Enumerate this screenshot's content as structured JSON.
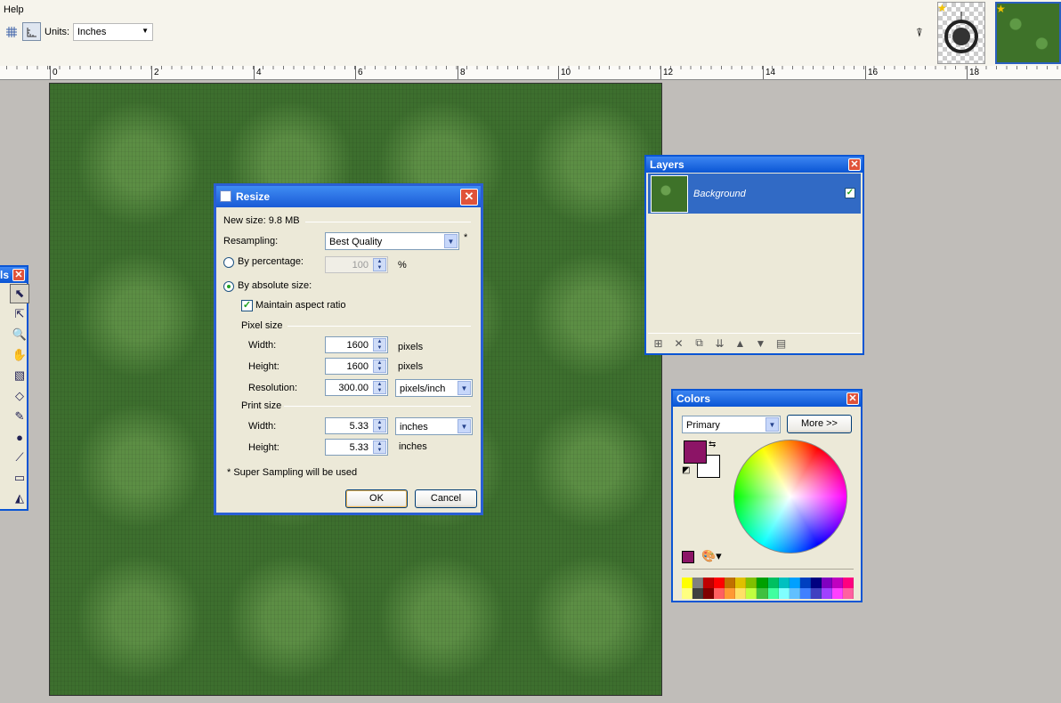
{
  "menu": {
    "help": "Help"
  },
  "toolbar": {
    "units_label": "Units:",
    "units_value": "Inches",
    "grid_icon": "grid-icon",
    "ruler_icon": "ruler-icon"
  },
  "ruler": {
    "labels": [
      "0",
      "2",
      "4",
      "6",
      "8",
      "10",
      "12",
      "14",
      "16",
      "18"
    ]
  },
  "tools_window": {
    "title": "ls"
  },
  "resize_dialog": {
    "title": "Resize",
    "new_size": "New size: 9.8 MB",
    "resampling_label": "Resampling:",
    "resampling_value": "Best Quality",
    "asterisk": "*",
    "by_percentage_label": "By percentage:",
    "percentage_value": "100",
    "percent_sign": "%",
    "by_absolute_label": "By absolute size:",
    "maintain_aspect_label": "Maintain aspect ratio",
    "pixel_size_label": "Pixel size",
    "width_label": "Width:",
    "width_px": "1600",
    "pixels_unit": "pixels",
    "height_label": "Height:",
    "height_px": "1600",
    "resolution_label": "Resolution:",
    "resolution_value": "300.00",
    "resolution_unit": "pixels/inch",
    "print_size_label": "Print size",
    "print_width": "5.33",
    "print_width_unit": "inches",
    "print_height": "5.33",
    "print_height_unit": "inches",
    "note": "* Super Sampling will be used",
    "ok": "OK",
    "cancel": "Cancel"
  },
  "layers_window": {
    "title": "Layers",
    "layer_name": "Background"
  },
  "colors_window": {
    "title": "Colors",
    "primary_select": "Primary",
    "more_button": "More >>",
    "primary_color": "#8c1466",
    "secondary_color": "#ffffff",
    "palette": [
      "#ffff00",
      "#808080",
      "#c00000",
      "#ff0000",
      "#c07000",
      "#e0c000",
      "#80c000",
      "#00a000",
      "#00c060",
      "#00c0c0",
      "#00a0ff",
      "#0040c0",
      "#000080",
      "#8000c0",
      "#c000c0",
      "#ff0080",
      "#ffff80",
      "#404040",
      "#800000",
      "#ff6060",
      "#ff9933",
      "#ffe066",
      "#c0ff40",
      "#40c040",
      "#40ffa0",
      "#80ffff",
      "#60c0ff",
      "#4080ff",
      "#4040c0",
      "#a040ff",
      "#ff40ff",
      "#ff60a0"
    ]
  },
  "close_glyph": "✕"
}
